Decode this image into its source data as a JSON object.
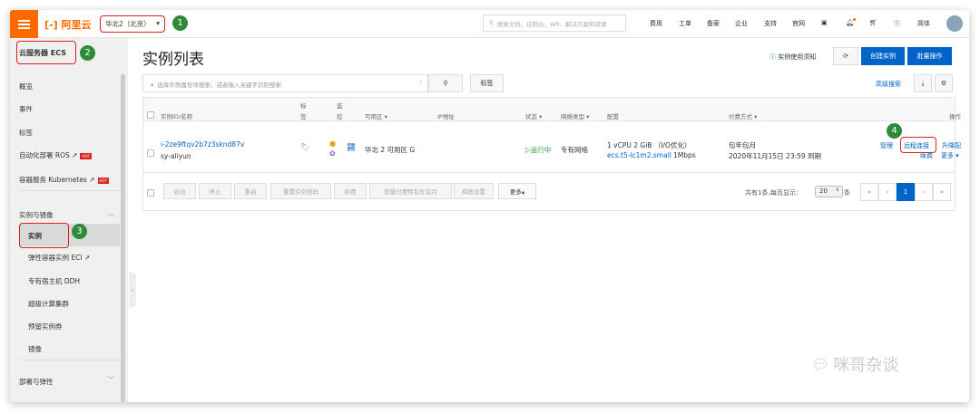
{
  "topbar": {
    "logo": "阿里云",
    "region": "华北2（北京）",
    "search_placeholder": "搜索文档、控制台、API、解决方案和资源",
    "nav": [
      "费用",
      "工单",
      "备案",
      "企业",
      "支持",
      "官网"
    ],
    "lang": "简体"
  },
  "badges": [
    "1",
    "2",
    "3",
    "4"
  ],
  "sidebar": {
    "title": "云服务器 ECS",
    "items": [
      {
        "label": "概览"
      },
      {
        "label": "事件"
      },
      {
        "label": "标签"
      },
      {
        "label": "自动化部署 ROS",
        "hot": "HOT"
      },
      {
        "label": "容器服务 Kubernetes",
        "hot": "HOT"
      }
    ],
    "group1": "实例与镜像",
    "sub": [
      "实例",
      "弹性容器实例 ECI",
      "专有宿主机 DDH",
      "超级计算集群",
      "预留实例券",
      "镜像"
    ],
    "group2": "部署与弹性"
  },
  "main": {
    "title": "实例列表",
    "notice": "实例使用须知",
    "create": "创建实例",
    "batch": "批量操作",
    "search_placeholder": "选择实例属性项搜索，或者输入关键字识别搜索",
    "tag_btn": "标签",
    "advanced": "高级搜索"
  },
  "table": {
    "headers": {
      "id": "实例ID/名称",
      "tag": "标签",
      "monitor": "监控",
      "zone": "可用区",
      "ip": "IP地址",
      "status": "状态",
      "network": "网络类型",
      "config": "配置",
      "billing": "付费方式",
      "ops": "操作"
    },
    "rows": [
      {
        "id": "i-2ze9ftqv2b7z3sknd87v",
        "name": "sy-aliyun",
        "zone": "华北 2 可用区 G",
        "status": "运行中",
        "network": "专有网络",
        "config1": "1 vCPU 2 GiB （I/O优化）",
        "config2": "ecs.t5-lc1m2.small",
        "bandwidth": "1Mbps",
        "billing1": "包年包月",
        "billing2": "2020年11月15日 23:59 到期",
        "ops": [
          "管理",
          "远程连接",
          "升降配",
          "续费",
          "更多"
        ]
      }
    ]
  },
  "footer": {
    "buttons": [
      "启动",
      "停止",
      "重启",
      "重置实例密码",
      "续费",
      "按量付费转包年包月",
      "释放设置"
    ],
    "more": "更多▴",
    "total": "共有1条，",
    "per_page_label": "每页显示：",
    "per_page": "20",
    "unit": "条",
    "pages": [
      "«",
      "‹",
      "1",
      "›",
      "»"
    ]
  },
  "watermark": "咪哥杂谈"
}
